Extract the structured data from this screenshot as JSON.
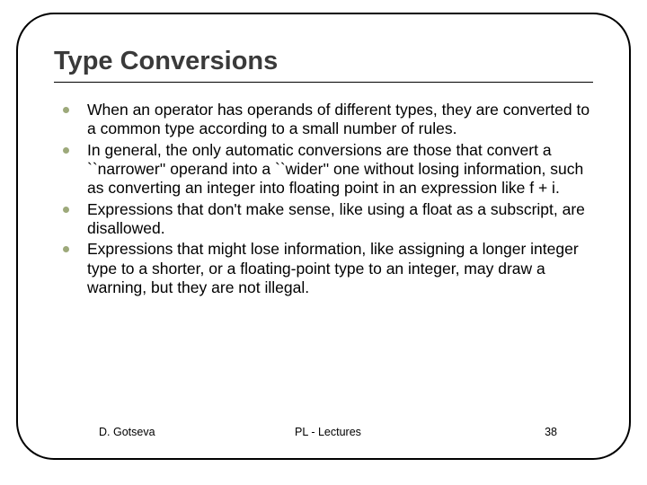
{
  "title": "Type Conversions",
  "bullets": [
    "When an operator has operands of different types, they are converted to a common type according to a small number of rules.",
    "In general, the only automatic conversions are those that convert a ``narrower'' operand into a ``wider'' one without losing information, such as converting an integer into floating point in an expression like f + i.",
    "Expressions that don't make sense, like using a float as a subscript, are disallowed.",
    "Expressions that might lose information, like assigning a longer integer type to a shorter, or a floating-point type to an integer, may draw a warning, but they are not illegal."
  ],
  "footer": {
    "author": "D. Gotseva",
    "center": "PL - Lectures",
    "page": "38"
  }
}
